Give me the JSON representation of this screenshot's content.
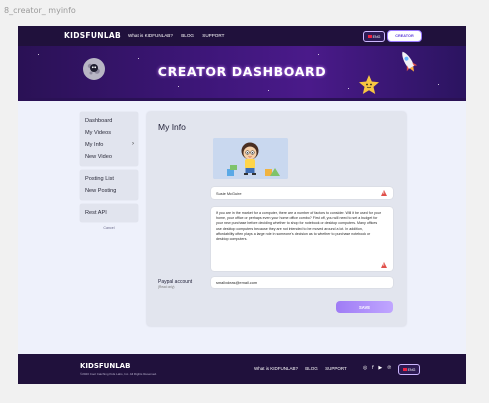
{
  "frame_label": "8_creator_ myinfo",
  "nav": {
    "logo": "KIDSFUNLAB",
    "links": [
      "What is KIDFUNLAB?",
      "BLOG",
      "SUPPORT"
    ],
    "lang": "ENG",
    "creator_button": "CREATOR"
  },
  "hero": {
    "title": "CREATOR DASHBOARD"
  },
  "sidebar": {
    "group1": [
      "Dashboard",
      "My Videos",
      "My Info",
      "New Video"
    ],
    "group2": [
      "Posting List",
      "New Posting"
    ],
    "group3": [
      "Rest API"
    ],
    "active": "My Info",
    "cancel_label": "Cancel"
  },
  "main": {
    "title": "My Info",
    "name_value": "Susie McGuire",
    "bio_value": "If you are in the market for a computer, there are a number of factors to consider. Will it be used for your home, your office or perhaps even your home office combo? First off, you will need to set a budget for your new purchase before deciding whether to shop for notebook or desktop computers. Many offices use desktop computers because they are not intended to be moved around a lot. In addition, affordability often plays a large role in someone's decision as to whether to purchase notebook or desktop computers.",
    "paypal_label": "Paypal account",
    "paypal_sublabel": "(Read only)",
    "paypal_value": "smallxdeas@email.com",
    "save_label": "SAVE"
  },
  "footer": {
    "logo": "KIDSFUNLAB",
    "copyright": "©2020 Cool Catching Kids Labs, Inc. All Rights Reserved.",
    "links": [
      "What is KIDFUNLAB?",
      "BLOG",
      "SUPPORT"
    ],
    "social": [
      "instagram-icon",
      "facebook-icon",
      "youtube-icon",
      "pinterest-icon"
    ],
    "lang": "ENG"
  },
  "colors": {
    "nav_bg": "#20113c",
    "hero_bg": "#3d1678",
    "accent": "#9f7cf5",
    "warning": "#e0504a"
  }
}
